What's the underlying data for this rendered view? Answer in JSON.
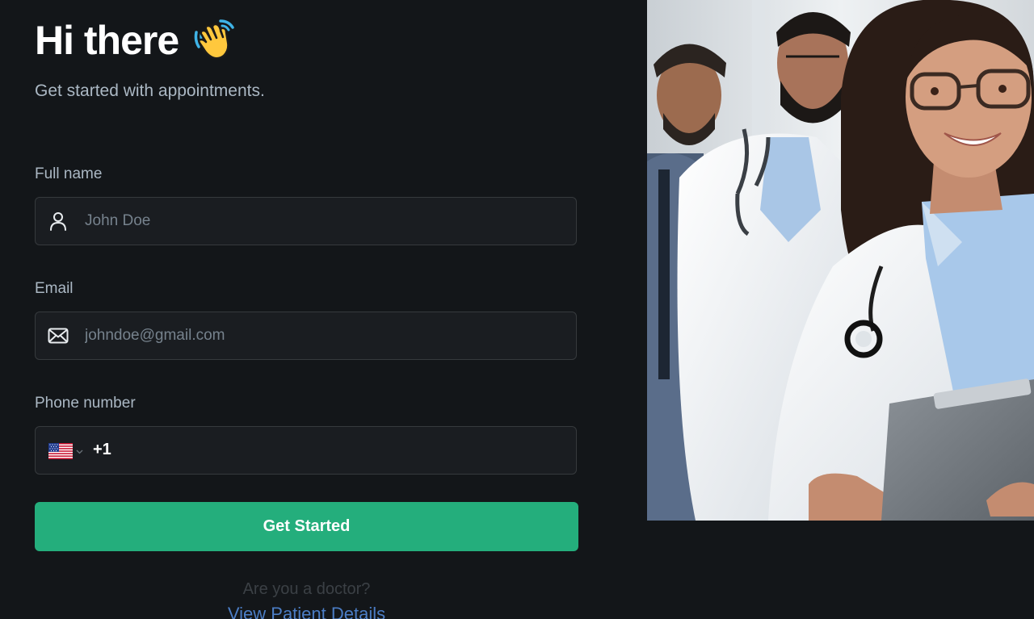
{
  "header": {
    "title": "Hi there",
    "subtitle": "Get started with appointments."
  },
  "form": {
    "full_name": {
      "label": "Full name",
      "placeholder": "John Doe",
      "icon": "user-icon"
    },
    "email": {
      "label": "Email",
      "placeholder": "johndoe@gmail.com",
      "icon": "mail-icon"
    },
    "phone": {
      "label": "Phone number",
      "country": "US",
      "dial_code": "+1",
      "value": ""
    },
    "submit_label": "Get Started"
  },
  "footer": {
    "doctor_question": "Are you a doctor?",
    "doctor_link": "View Patient Details"
  },
  "colors": {
    "background": "#131619",
    "input_bg": "#1a1d21",
    "input_border": "#363a3d",
    "accent": "#24ae7c",
    "link": "#4b7dc5"
  }
}
